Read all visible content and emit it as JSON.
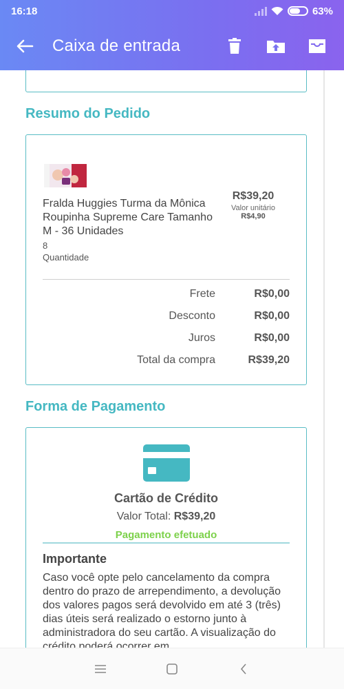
{
  "status": {
    "time": "16:18",
    "battery": "63%"
  },
  "header": {
    "title": "Caixa de entrada",
    "icons": [
      "back-arrow-icon",
      "trash-icon",
      "upload-folder-icon",
      "archive-icon"
    ]
  },
  "order": {
    "section_title": "Resumo do Pedido",
    "product": {
      "name": "Fralda Huggies Turma da Mônica Roupinha Supreme Care Tamanho M - 36 Unidades",
      "quantity": "8",
      "quantity_label": "Quantidade",
      "price": "R$39,20",
      "unit_label": "Valor unitário",
      "unit_price": "R$4,90"
    },
    "summary": [
      {
        "label": "Frete",
        "value": "R$0,00"
      },
      {
        "label": "Desconto",
        "value": "R$0,00"
      },
      {
        "label": "Juros",
        "value": "R$0,00"
      },
      {
        "label": "Total da compra",
        "value": "R$39,20"
      }
    ]
  },
  "payment": {
    "section_title": "Forma de Pagamento",
    "method": "Cartão de Crédito",
    "total_label": "Valor Total:",
    "total_value": "R$39,20",
    "status": "Pagamento efetuado",
    "important_title": "Importante",
    "important_text": "Caso você opte pelo cancelamento da compra dentro do prazo de arrependimento, a devolução dos valores pagos será devolvido em até 3 (três) dias úteis será realizado o estorno junto à administradora do seu cartão. A visualização do crédito poderá ocorrer em"
  },
  "colors": {
    "accent": "#45b8c2",
    "header_start": "#6a89f4",
    "header_end": "#8a63ee",
    "success": "#7cd14a"
  },
  "nav": {
    "icons": [
      "menu-icon",
      "home-square-icon",
      "back-chevron-icon"
    ]
  }
}
